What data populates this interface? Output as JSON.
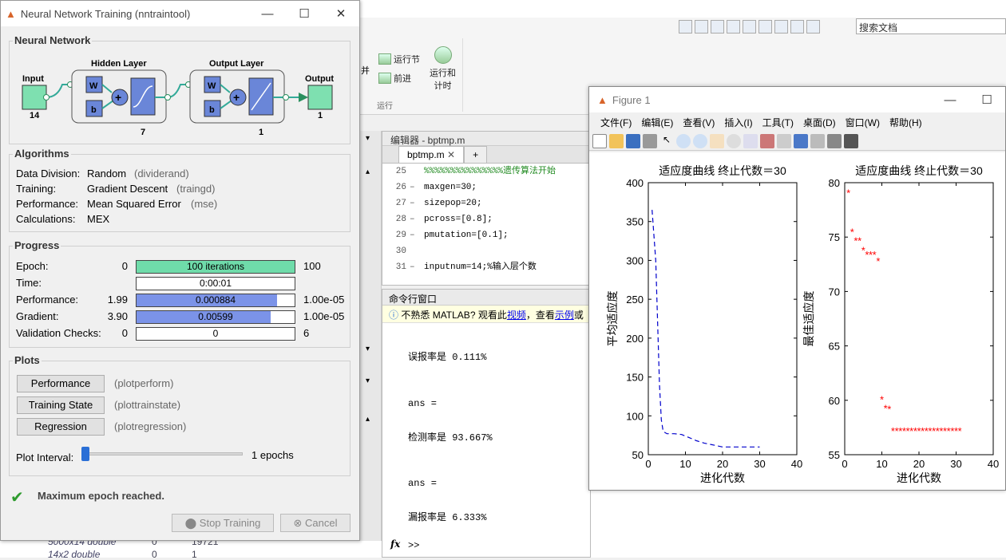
{
  "matlab": {
    "search_placeholder": "搜索文档",
    "run_section": {
      "run_section": "运行节",
      "advance": "前进",
      "run_and_time": "运行和\n计时",
      "section_label": "运行",
      "left_partial": "并"
    },
    "editor": {
      "title": "编辑器 - bptmp.m",
      "tab": "bptmp.m",
      "lines": [
        {
          "n": "25",
          "dash": "",
          "text": "%%%%%%%%%%%%%%%遗传算法开始",
          "comment": true
        },
        {
          "n": "26",
          "dash": "–",
          "text": "maxgen=30;",
          "comment": false
        },
        {
          "n": "27",
          "dash": "–",
          "text": "sizepop=20;",
          "comment": false
        },
        {
          "n": "28",
          "dash": "–",
          "text": "pcross=[0.8];",
          "comment": false
        },
        {
          "n": "29",
          "dash": "–",
          "text": "pmutation=[0.1];",
          "comment": false
        },
        {
          "n": "30",
          "dash": "",
          "text": "",
          "comment": false
        },
        {
          "n": "31",
          "dash": "–",
          "text": "inputnum=14;%输入层个数",
          "comment": false
        }
      ]
    },
    "command": {
      "title": "命令行窗口",
      "info_prefix": "不熟悉 MATLAB? 观看此",
      "info_link1": "视频",
      "info_mid": "，查看",
      "info_link2": "示例",
      "info_suffix": "或",
      "lines": [
        "误报率是 0.111%",
        "ans =",
        "检测率是 93.667%",
        "ans =",
        "漏报率是 6.333%"
      ],
      "prompt": ">>",
      "fx": "fx"
    },
    "workspace_partial": {
      "type": "5000x14 double",
      "v1": "0",
      "v2": "19721",
      "type2": "14x2 double",
      "v3": "0",
      "v4": "1"
    }
  },
  "nntraintool": {
    "title": "Neural Network Training (nntraintool)",
    "network": {
      "section": "Neural Network",
      "input_label": "Input",
      "input_size": "14",
      "hidden_label": "Hidden Layer",
      "hidden_size": "7",
      "output_layer_label": "Output Layer",
      "output_layer_size": "1",
      "output_label": "Output",
      "output_size": "1",
      "w": "W",
      "b": "b"
    },
    "algorithms": {
      "section": "Algorithms",
      "rows": [
        {
          "label": "Data Division:",
          "value": "Random",
          "fn": "(dividerand)"
        },
        {
          "label": "Training:",
          "value": "Gradient Descent",
          "fn": "(traingd)"
        },
        {
          "label": "Performance:",
          "value": "Mean Squared Error",
          "fn": "(mse)"
        },
        {
          "label": "Calculations:",
          "value": "MEX",
          "fn": ""
        }
      ]
    },
    "progress": {
      "section": "Progress",
      "rows": [
        {
          "label": "Epoch:",
          "start": "0",
          "bar": "100 iterations",
          "end": "100",
          "fill": 1.0,
          "color": "#6fdcaa"
        },
        {
          "label": "Time:",
          "start": "",
          "bar": "0:00:01",
          "end": "",
          "fill": 0,
          "color": "#7b93e8"
        },
        {
          "label": "Performance:",
          "start": "1.99",
          "bar": "0.000884",
          "end": "1.00e-05",
          "fill": 0.89,
          "color": "#7b93e8"
        },
        {
          "label": "Gradient:",
          "start": "3.90",
          "bar": "0.00599",
          "end": "1.00e-05",
          "fill": 0.85,
          "color": "#7b93e8"
        },
        {
          "label": "Validation Checks:",
          "start": "0",
          "bar": "0",
          "end": "6",
          "fill": 0,
          "color": "#7b93e8"
        }
      ]
    },
    "plots": {
      "section": "Plots",
      "buttons": [
        {
          "label": "Performance",
          "fn": "(plotperform)"
        },
        {
          "label": "Training State",
          "fn": "(plottrainstate)"
        },
        {
          "label": "Regression",
          "fn": "(plotregression)"
        }
      ],
      "interval_label": "Plot Interval:",
      "interval_value": "1 epochs",
      "slider_value": 0
    },
    "status": "Maximum epoch reached.",
    "stop_button": "Stop Training",
    "cancel_button": "Cancel"
  },
  "figure": {
    "title": "Figure 1",
    "menu": [
      "文件(F)",
      "编辑(E)",
      "查看(V)",
      "插入(I)",
      "工具(T)",
      "桌面(D)",
      "窗口(W)",
      "帮助(H)"
    ]
  },
  "chart_data": [
    {
      "type": "line",
      "title": "适应度曲线  终止代数＝30",
      "xlabel": "进化代数",
      "ylabel": "平均适应度",
      "xlim": [
        0,
        40
      ],
      "ylim": [
        50,
        400
      ],
      "xticks": [
        0,
        10,
        20,
        30,
        40
      ],
      "yticks": [
        50,
        100,
        150,
        200,
        250,
        300,
        350,
        400
      ],
      "style": "dashed",
      "color": "#0000cc",
      "x": [
        1,
        2,
        3,
        3.5,
        4,
        5,
        7,
        9,
        11,
        13,
        15,
        18,
        20,
        25,
        30
      ],
      "y": [
        365,
        300,
        140,
        95,
        80,
        77,
        77,
        76,
        72,
        68,
        65,
        62,
        60,
        60,
        60
      ]
    },
    {
      "type": "scatter",
      "title": "适应度曲线  终止代数＝30",
      "xlabel": "进化代数",
      "ylabel": "最佳适应度",
      "xlim": [
        0,
        40
      ],
      "ylim": [
        55,
        80
      ],
      "xticks": [
        0,
        10,
        20,
        30,
        40
      ],
      "yticks": [
        55,
        60,
        65,
        70,
        75,
        80
      ],
      "marker": "*",
      "color": "#ff0000",
      "x": [
        1,
        2,
        3,
        4,
        5,
        6,
        7,
        8,
        9,
        10,
        11,
        12,
        13,
        14,
        15,
        16,
        17,
        18,
        19,
        20,
        21,
        22,
        23,
        24,
        25,
        26,
        27,
        28,
        29,
        30,
        31
      ],
      "y": [
        79.1,
        75.5,
        74.7,
        74.7,
        73.8,
        73.4,
        73.4,
        73.4,
        72.8,
        60.1,
        59.3,
        59.2,
        57.2,
        57.2,
        57.2,
        57.2,
        57.2,
        57.2,
        57.2,
        57.2,
        57.2,
        57.2,
        57.2,
        57.2,
        57.2,
        57.2,
        57.2,
        57.2,
        57.2,
        57.2,
        57.2
      ]
    }
  ]
}
